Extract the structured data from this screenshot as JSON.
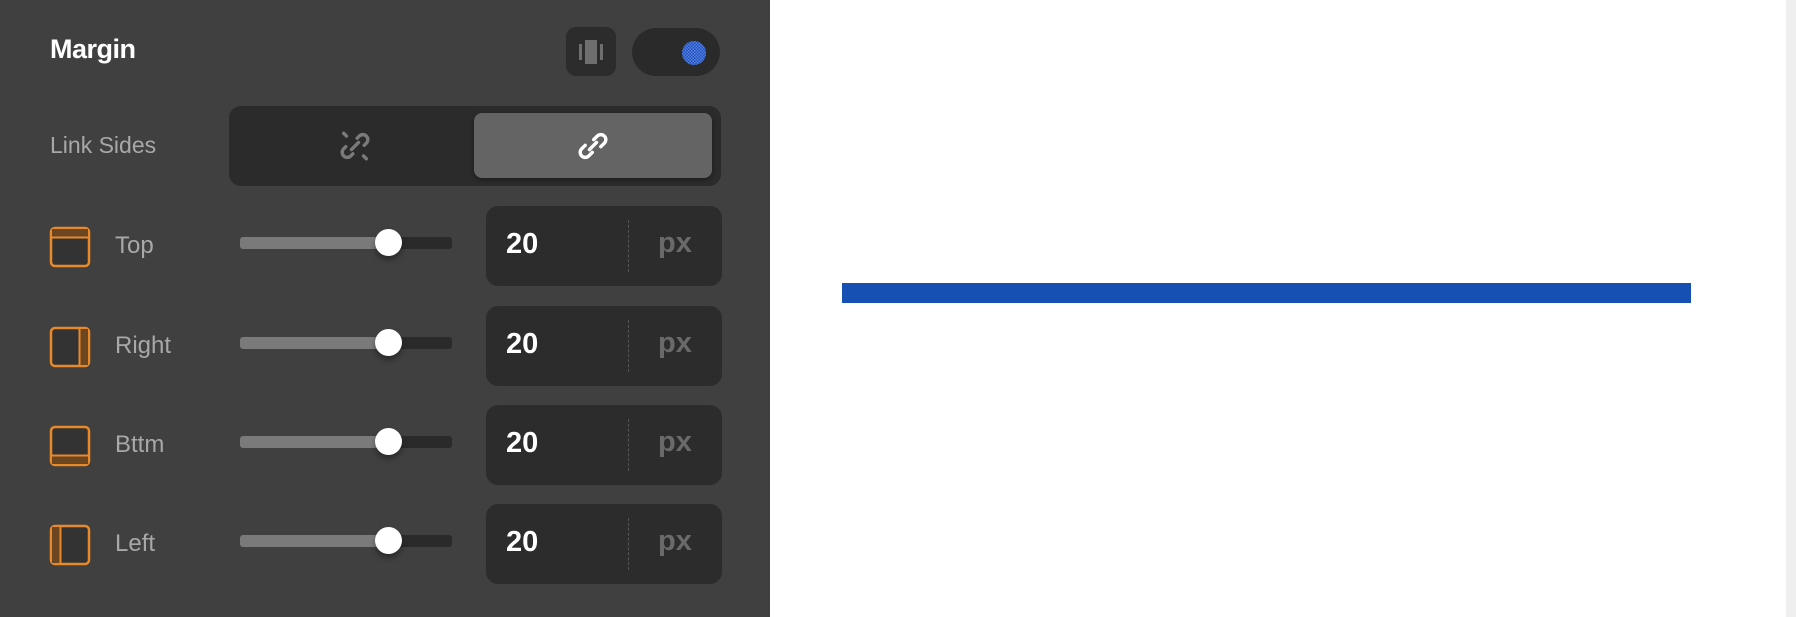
{
  "panel": {
    "title": "Margin",
    "view_toggle_icon": "columns-view-icon",
    "toggle": {
      "state": "on",
      "knob_color": "#1b4fc4"
    },
    "link_sides": {
      "label": "Link Sides",
      "options": [
        {
          "name": "unlinked",
          "icon": "unlink-icon",
          "selected": false
        },
        {
          "name": "linked",
          "icon": "link-icon",
          "selected": true
        }
      ]
    },
    "sides": [
      {
        "key": "top",
        "label": "Top",
        "icon": "margin-top-icon",
        "value": "20",
        "unit": "px",
        "slider_fraction": 0.7
      },
      {
        "key": "right",
        "label": "Right",
        "icon": "margin-right-icon",
        "value": "20",
        "unit": "px",
        "slider_fraction": 0.7
      },
      {
        "key": "bottom",
        "label": "Bttm",
        "icon": "margin-bottom-icon",
        "value": "20",
        "unit": "px",
        "slider_fraction": 0.7
      },
      {
        "key": "left",
        "label": "Left",
        "icon": "margin-left-icon",
        "value": "20",
        "unit": "px",
        "slider_fraction": 0.7
      }
    ]
  },
  "colors": {
    "panel_bg": "#404040",
    "accent_orange": "#e8892a",
    "preview_bar": "#1550b2"
  }
}
